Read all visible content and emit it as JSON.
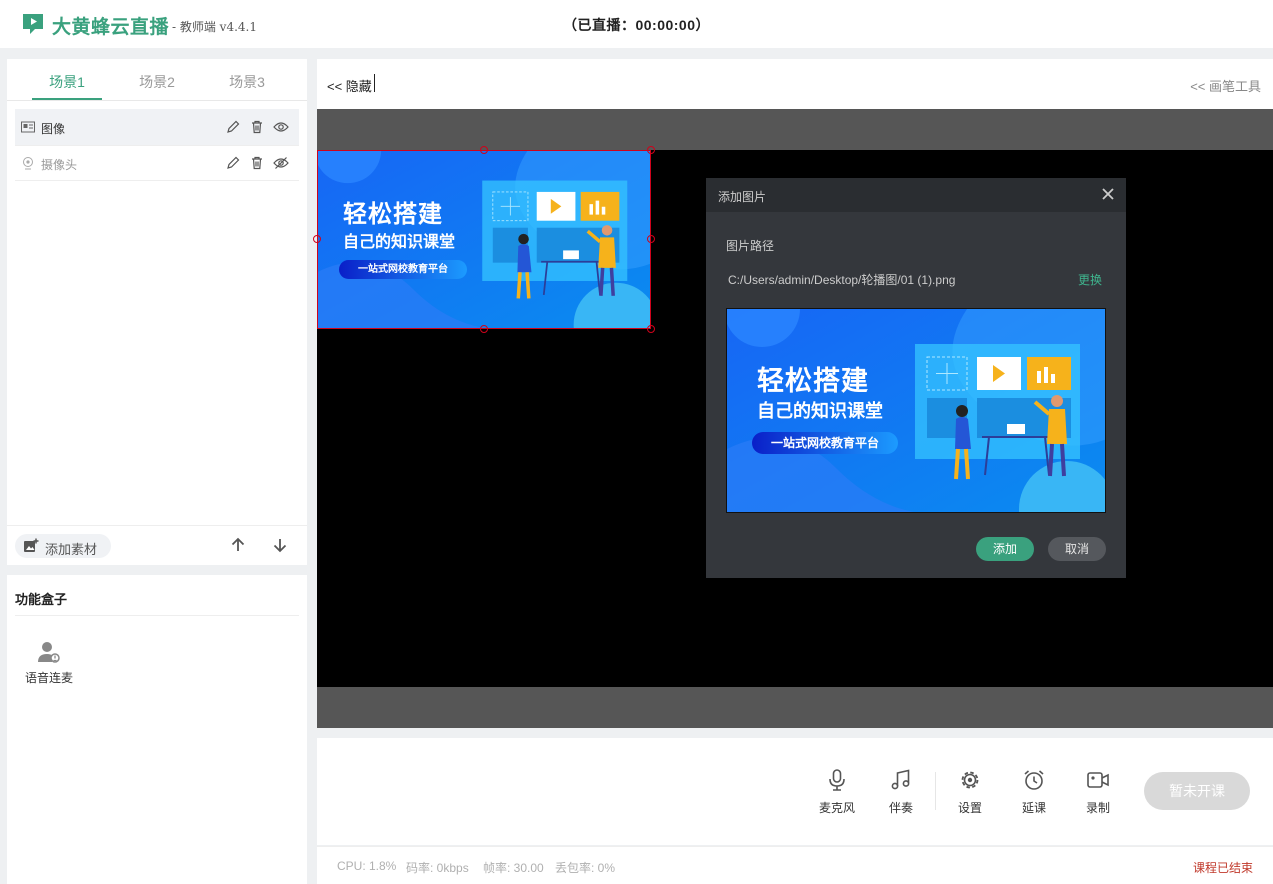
{
  "header": {
    "app_name": "大黄蜂云直播",
    "app_sub": "- 教师端 v4.4.1",
    "live_status": "（已直播：00:00:00）",
    "brand_color": "#3aa17e"
  },
  "scenes": {
    "tabs": [
      {
        "label": "场景1",
        "active": true
      },
      {
        "label": "场景2",
        "active": false
      },
      {
        "label": "场景3",
        "active": false
      }
    ],
    "items": [
      {
        "label": "图像",
        "icon": "image-icon",
        "visible": true,
        "selected": true
      },
      {
        "label": "摄像头",
        "icon": "camera-icon",
        "visible": false,
        "selected": false
      }
    ],
    "add_material": "添加素材"
  },
  "function_box": {
    "title": "功能盒子",
    "items": [
      {
        "label": "语音连麦",
        "icon": "voice-connect-icon"
      }
    ]
  },
  "toolbar": {
    "hide_label": "<< 隐藏",
    "pen_tools_label": "<< 画笔工具"
  },
  "banner": {
    "headline": "轻松搭建",
    "subline": "自己的知识课堂",
    "pill": "一站式网校教育平台"
  },
  "dialog": {
    "title": "添加图片",
    "path_label": "图片路径",
    "path_value": "C:/Users/admin/Desktop/轮播图/01 (1).png",
    "replace": "更换",
    "add": "添加",
    "cancel": "取消"
  },
  "controls": {
    "mic": "麦克风",
    "music": "伴奏",
    "settings": "设置",
    "delay": "延课",
    "record": "录制",
    "start": "暂未开课"
  },
  "status": {
    "cpu": "CPU: 1.8%",
    "bitrate": "码率: 0kbps",
    "fps": "帧率: 30.00",
    "loss": "丢包率: 0%",
    "course_state": "课程已结束"
  }
}
